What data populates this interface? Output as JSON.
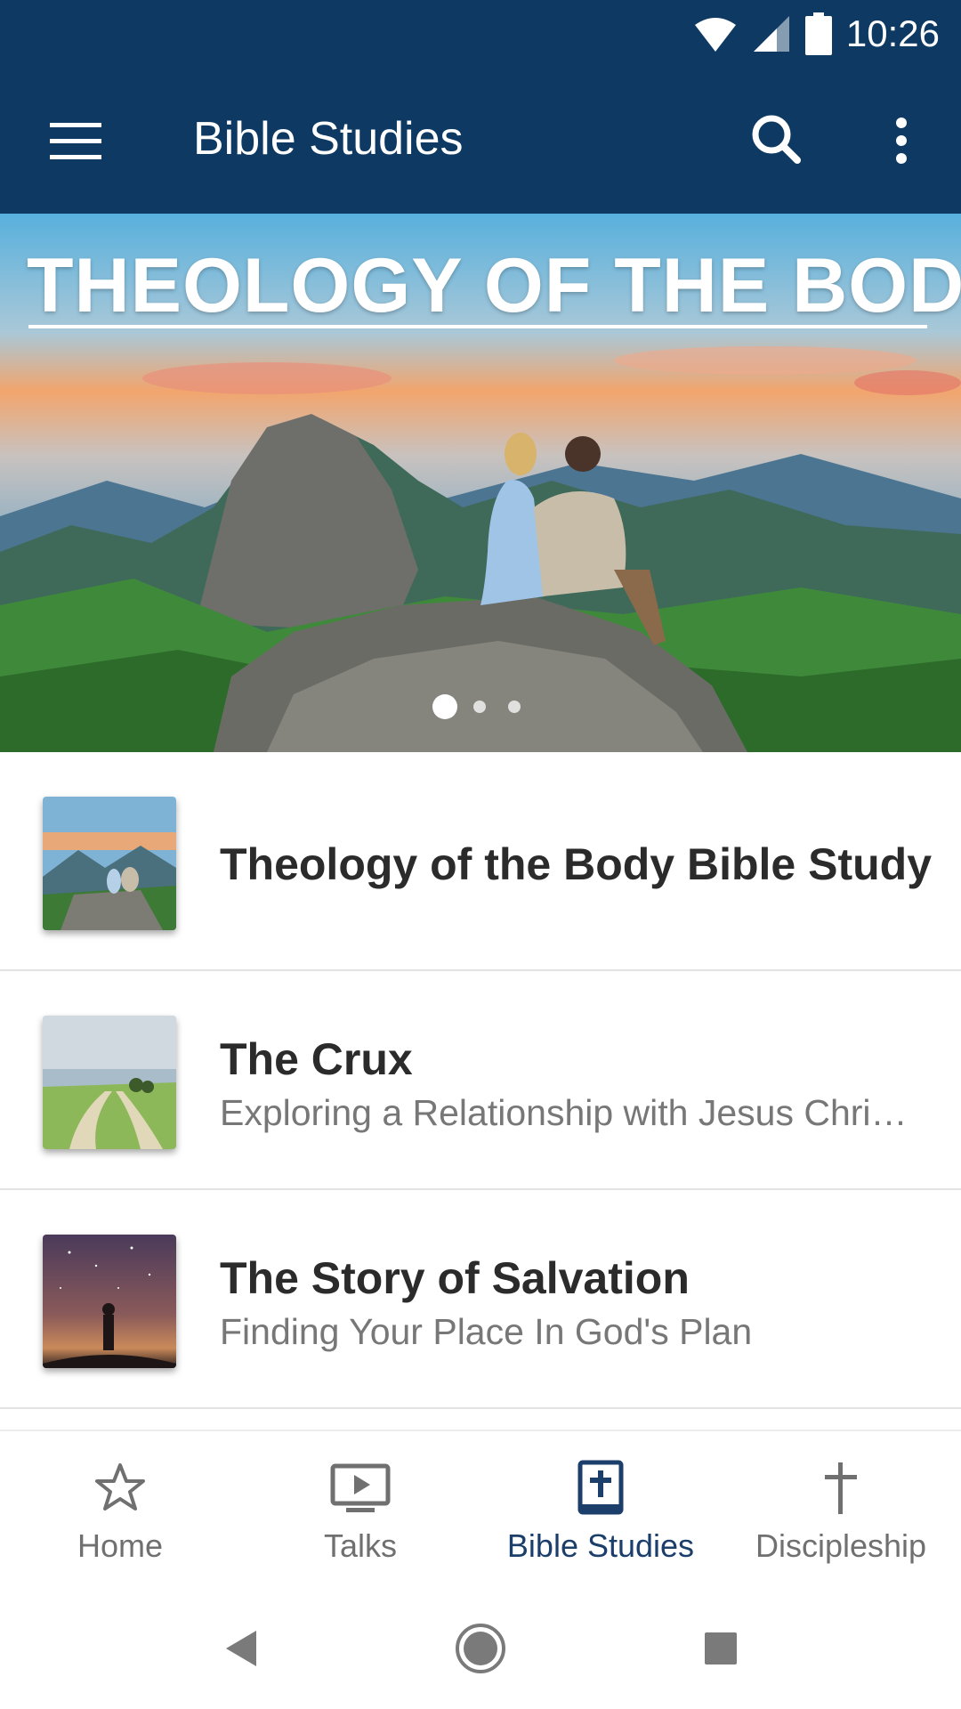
{
  "status_bar": {
    "time": "10:26"
  },
  "app_bar": {
    "title": "Bible Studies"
  },
  "hero": {
    "title": "THEOLOGY OF THE BODY"
  },
  "list": [
    {
      "title": "Theology of the Body Bible Study",
      "subtitle": ""
    },
    {
      "title": "The Crux",
      "subtitle": "Exploring a Relationship with Jesus Chri…"
    },
    {
      "title": "The Story of Salvation",
      "subtitle": "Finding Your Place In God's Plan"
    }
  ],
  "bottom_nav": [
    {
      "label": "Home",
      "icon": "star-icon",
      "active": false
    },
    {
      "label": "Talks",
      "icon": "tv-play-icon",
      "active": false
    },
    {
      "label": "Bible Studies",
      "icon": "bible-icon",
      "active": true
    },
    {
      "label": "Discipleship",
      "icon": "cross-icon",
      "active": false
    }
  ],
  "colors": {
    "primary": "#0d3963",
    "active_nav": "#1b3e6a",
    "inactive_nav": "#707070"
  }
}
